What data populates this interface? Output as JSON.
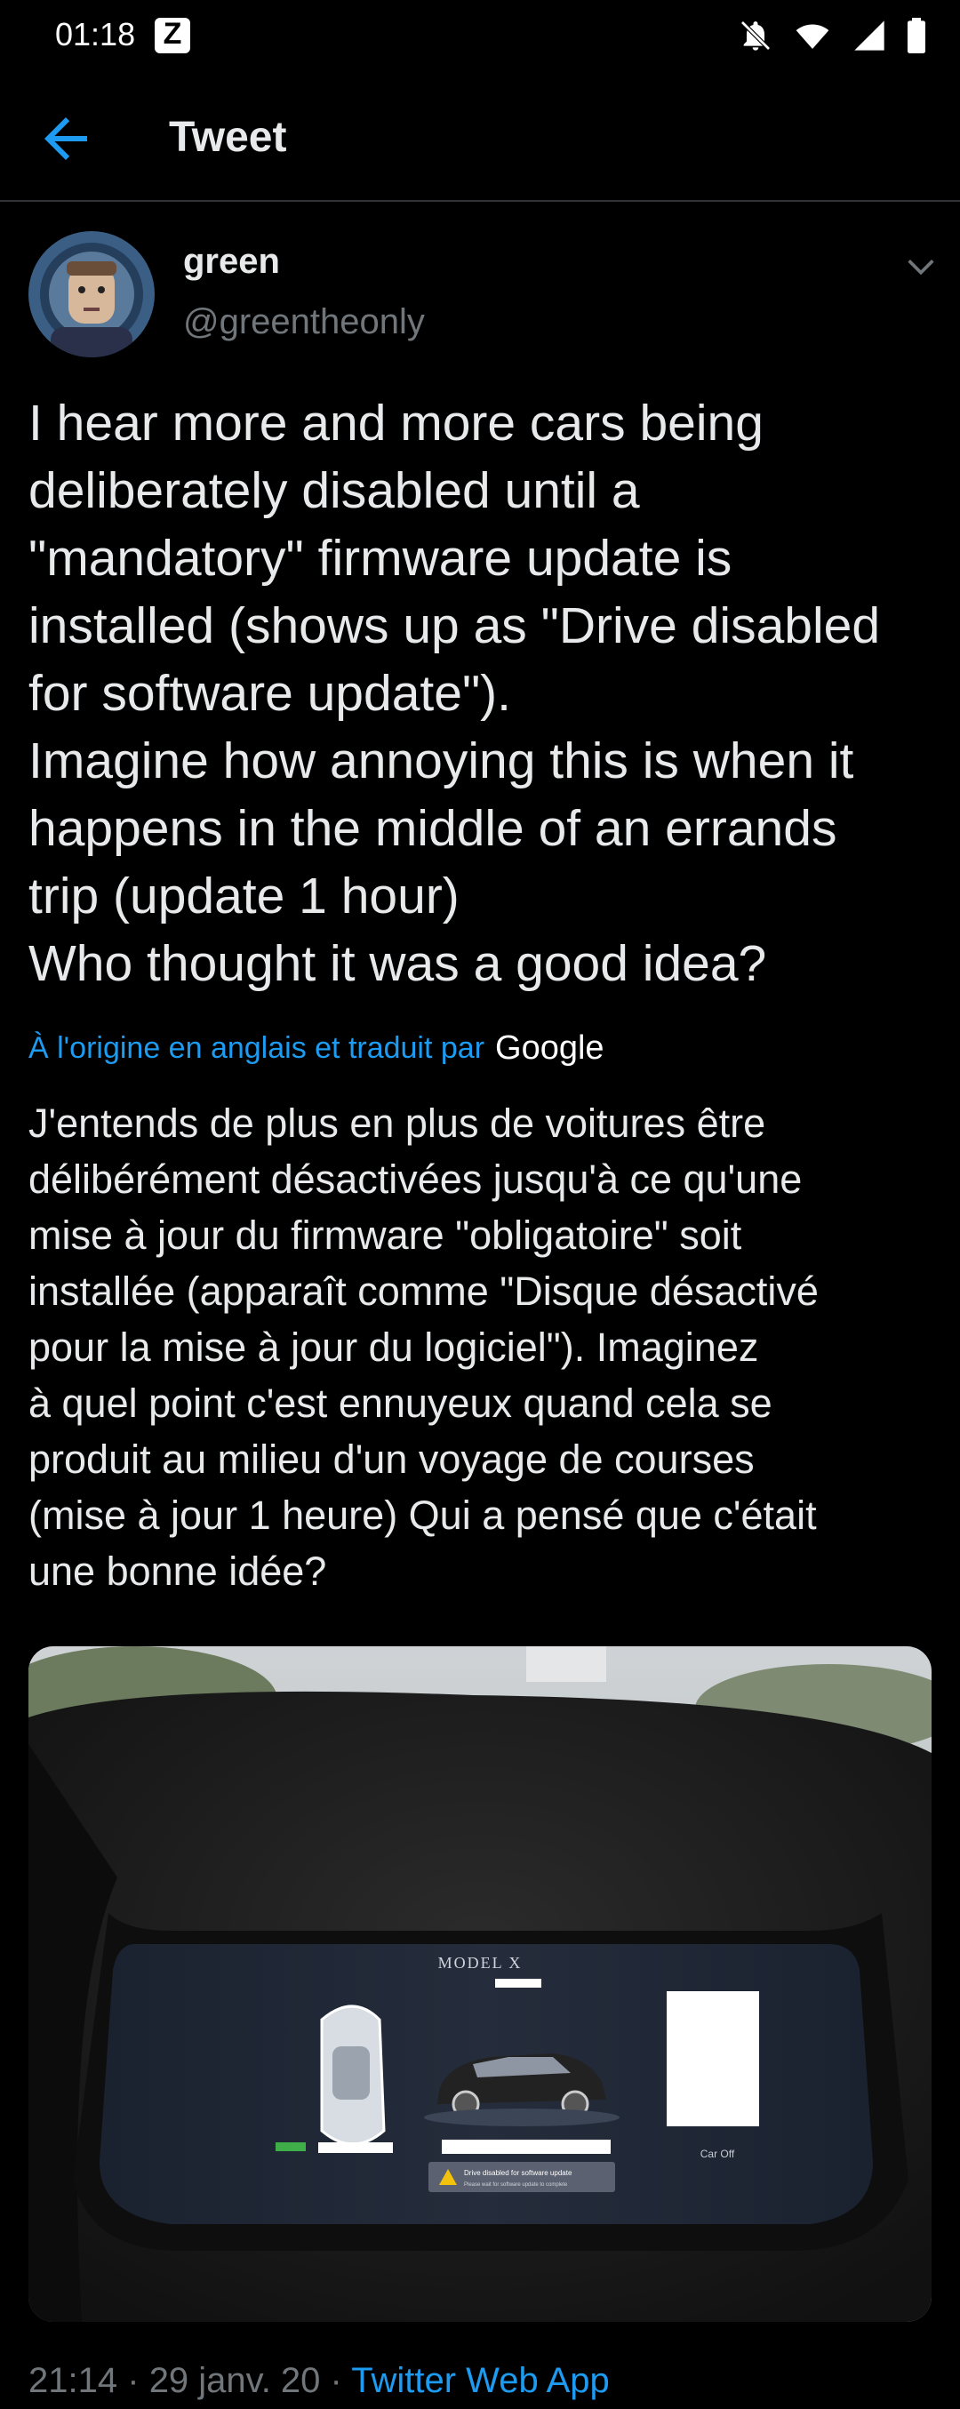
{
  "status_bar": {
    "time": "01:18",
    "notification_app": "Z"
  },
  "header": {
    "title": "Tweet"
  },
  "tweet": {
    "author_name": "green",
    "author_handle": "@greentheonly",
    "text": "I hear more and more cars being\ndeliberately disabled until a\n\"mandatory\" firmware update is\ninstalled (shows up as \"Drive disabled\nfor software update\").\nImagine how annoying this is when it\nhappens in the middle of an errands\ntrip (update 1 hour)\nWho thought it was a good idea?",
    "translation_label": "À l'origine en anglais et traduit par",
    "translation_provider": "Google",
    "translated_text": "J'entends de plus en plus de voitures être\ndélibérément désactivées jusqu'à ce qu'une\nmise à jour du firmware \"obligatoire\" soit\ninstallée (apparaît comme \"Disque désactivé\npour la mise à jour du logiciel\"). Imaginez\nà quel point c'est ennuyeux quand cela se\nproduit au milieu d'un voyage de courses\n(mise à jour 1 heure) Qui a pensé que c'était\nune bonne idée?",
    "media": {
      "screen_title": "MODEL X",
      "alert_line1": "Drive disabled for software update",
      "alert_line2": "Please wait for software update to complete",
      "right_label": "Car Off"
    },
    "time": "21:14",
    "date": "29 janv. 20",
    "separator": "·",
    "source": "Twitter Web App"
  },
  "colors": {
    "accent": "#1d9bf0",
    "secondary_text": "#71767b",
    "divider": "#2f3336"
  }
}
